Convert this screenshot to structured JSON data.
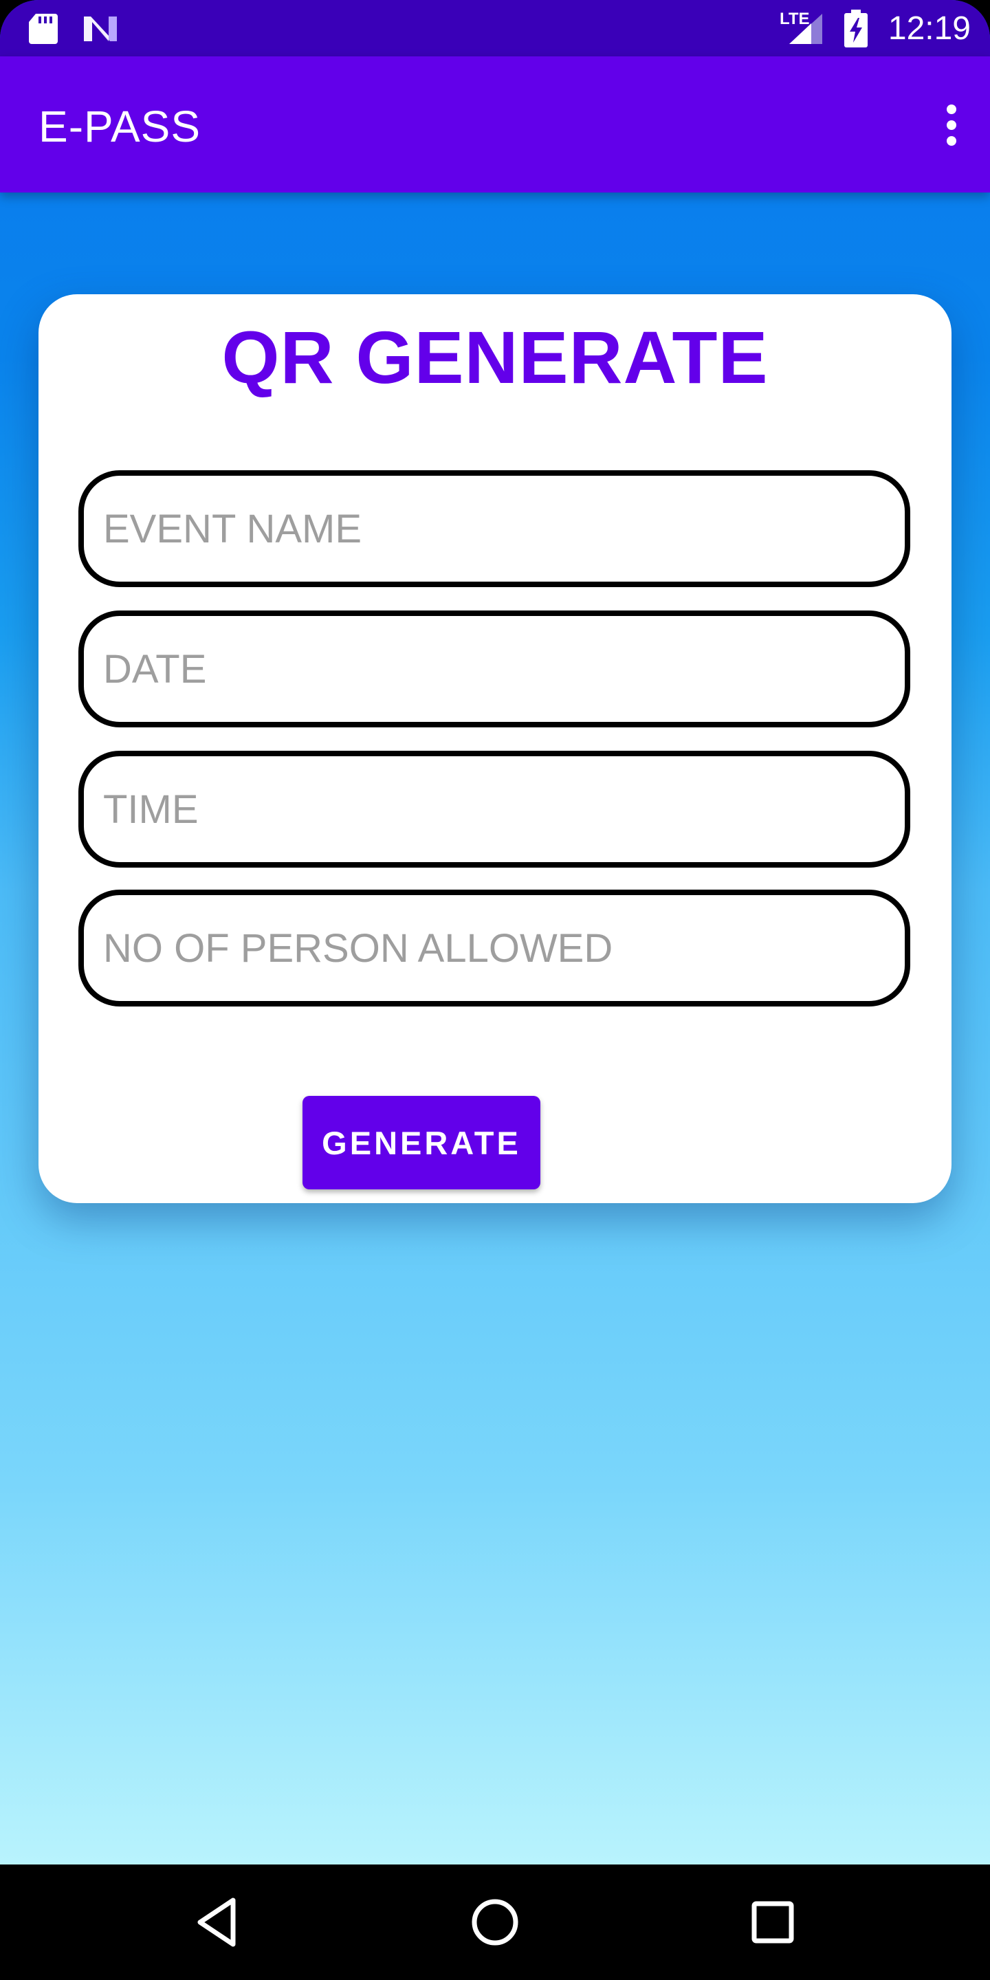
{
  "status_bar": {
    "time": "12:19",
    "left_icons": [
      "sd-card-icon",
      "n-notification-icon"
    ],
    "right_icons": [
      "lte-signal-icon",
      "battery-charging-icon"
    ],
    "network_label": "LTE",
    "background": "#3a00b8"
  },
  "app_bar": {
    "title": "E-PASS",
    "background": "#6200ea",
    "menu_icon": "more-vert-icon"
  },
  "card": {
    "title": "QR GENERATE",
    "title_color": "#6300ea",
    "fields": [
      {
        "placeholder": "EVENT NAME",
        "value": ""
      },
      {
        "placeholder": "DATE",
        "value": ""
      },
      {
        "placeholder": "TIME",
        "value": ""
      },
      {
        "placeholder": "NO OF PERSON ALLOWED",
        "value": ""
      }
    ],
    "generate_label": "GENERATE",
    "button_color": "#6200ea"
  },
  "nav_bar": {
    "icons": [
      "back-icon",
      "home-icon",
      "recents-icon"
    ]
  }
}
